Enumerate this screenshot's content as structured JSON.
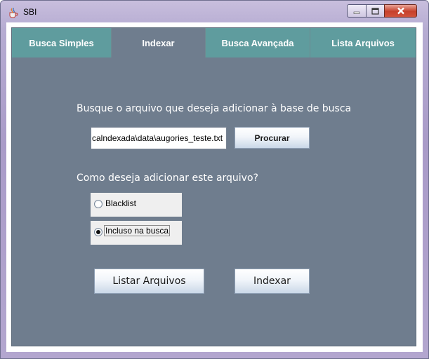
{
  "window": {
    "title": "SBI",
    "icon": "java-cup-icon",
    "controls": {
      "minimize": "minimize-icon",
      "maximize": "maximize-icon",
      "close": "close-icon"
    }
  },
  "tabs": [
    {
      "label": "Busca Simples",
      "active": false
    },
    {
      "label": "Indexar",
      "active": true
    },
    {
      "label": "Busca Avançada",
      "active": false
    },
    {
      "label": "Lista Arquivos",
      "active": false
    }
  ],
  "indexar": {
    "file_prompt": "Busque o arquivo que deseja adicionar à base de busca",
    "file_path": "calndexada\\data\\augories_teste.txt",
    "browse_label": "Procurar",
    "mode_prompt": "Como deseja adicionar este arquivo?",
    "options": [
      {
        "label": "Blacklist",
        "selected": false
      },
      {
        "label": "Incluso na busca",
        "selected": true
      }
    ],
    "list_files_label": "Listar Arquivos",
    "index_label": "Indexar"
  },
  "colors": {
    "panel_bg": "#6f7d8e",
    "tab_bg": "#5f9c9e",
    "tab_text": "#ffffff"
  }
}
